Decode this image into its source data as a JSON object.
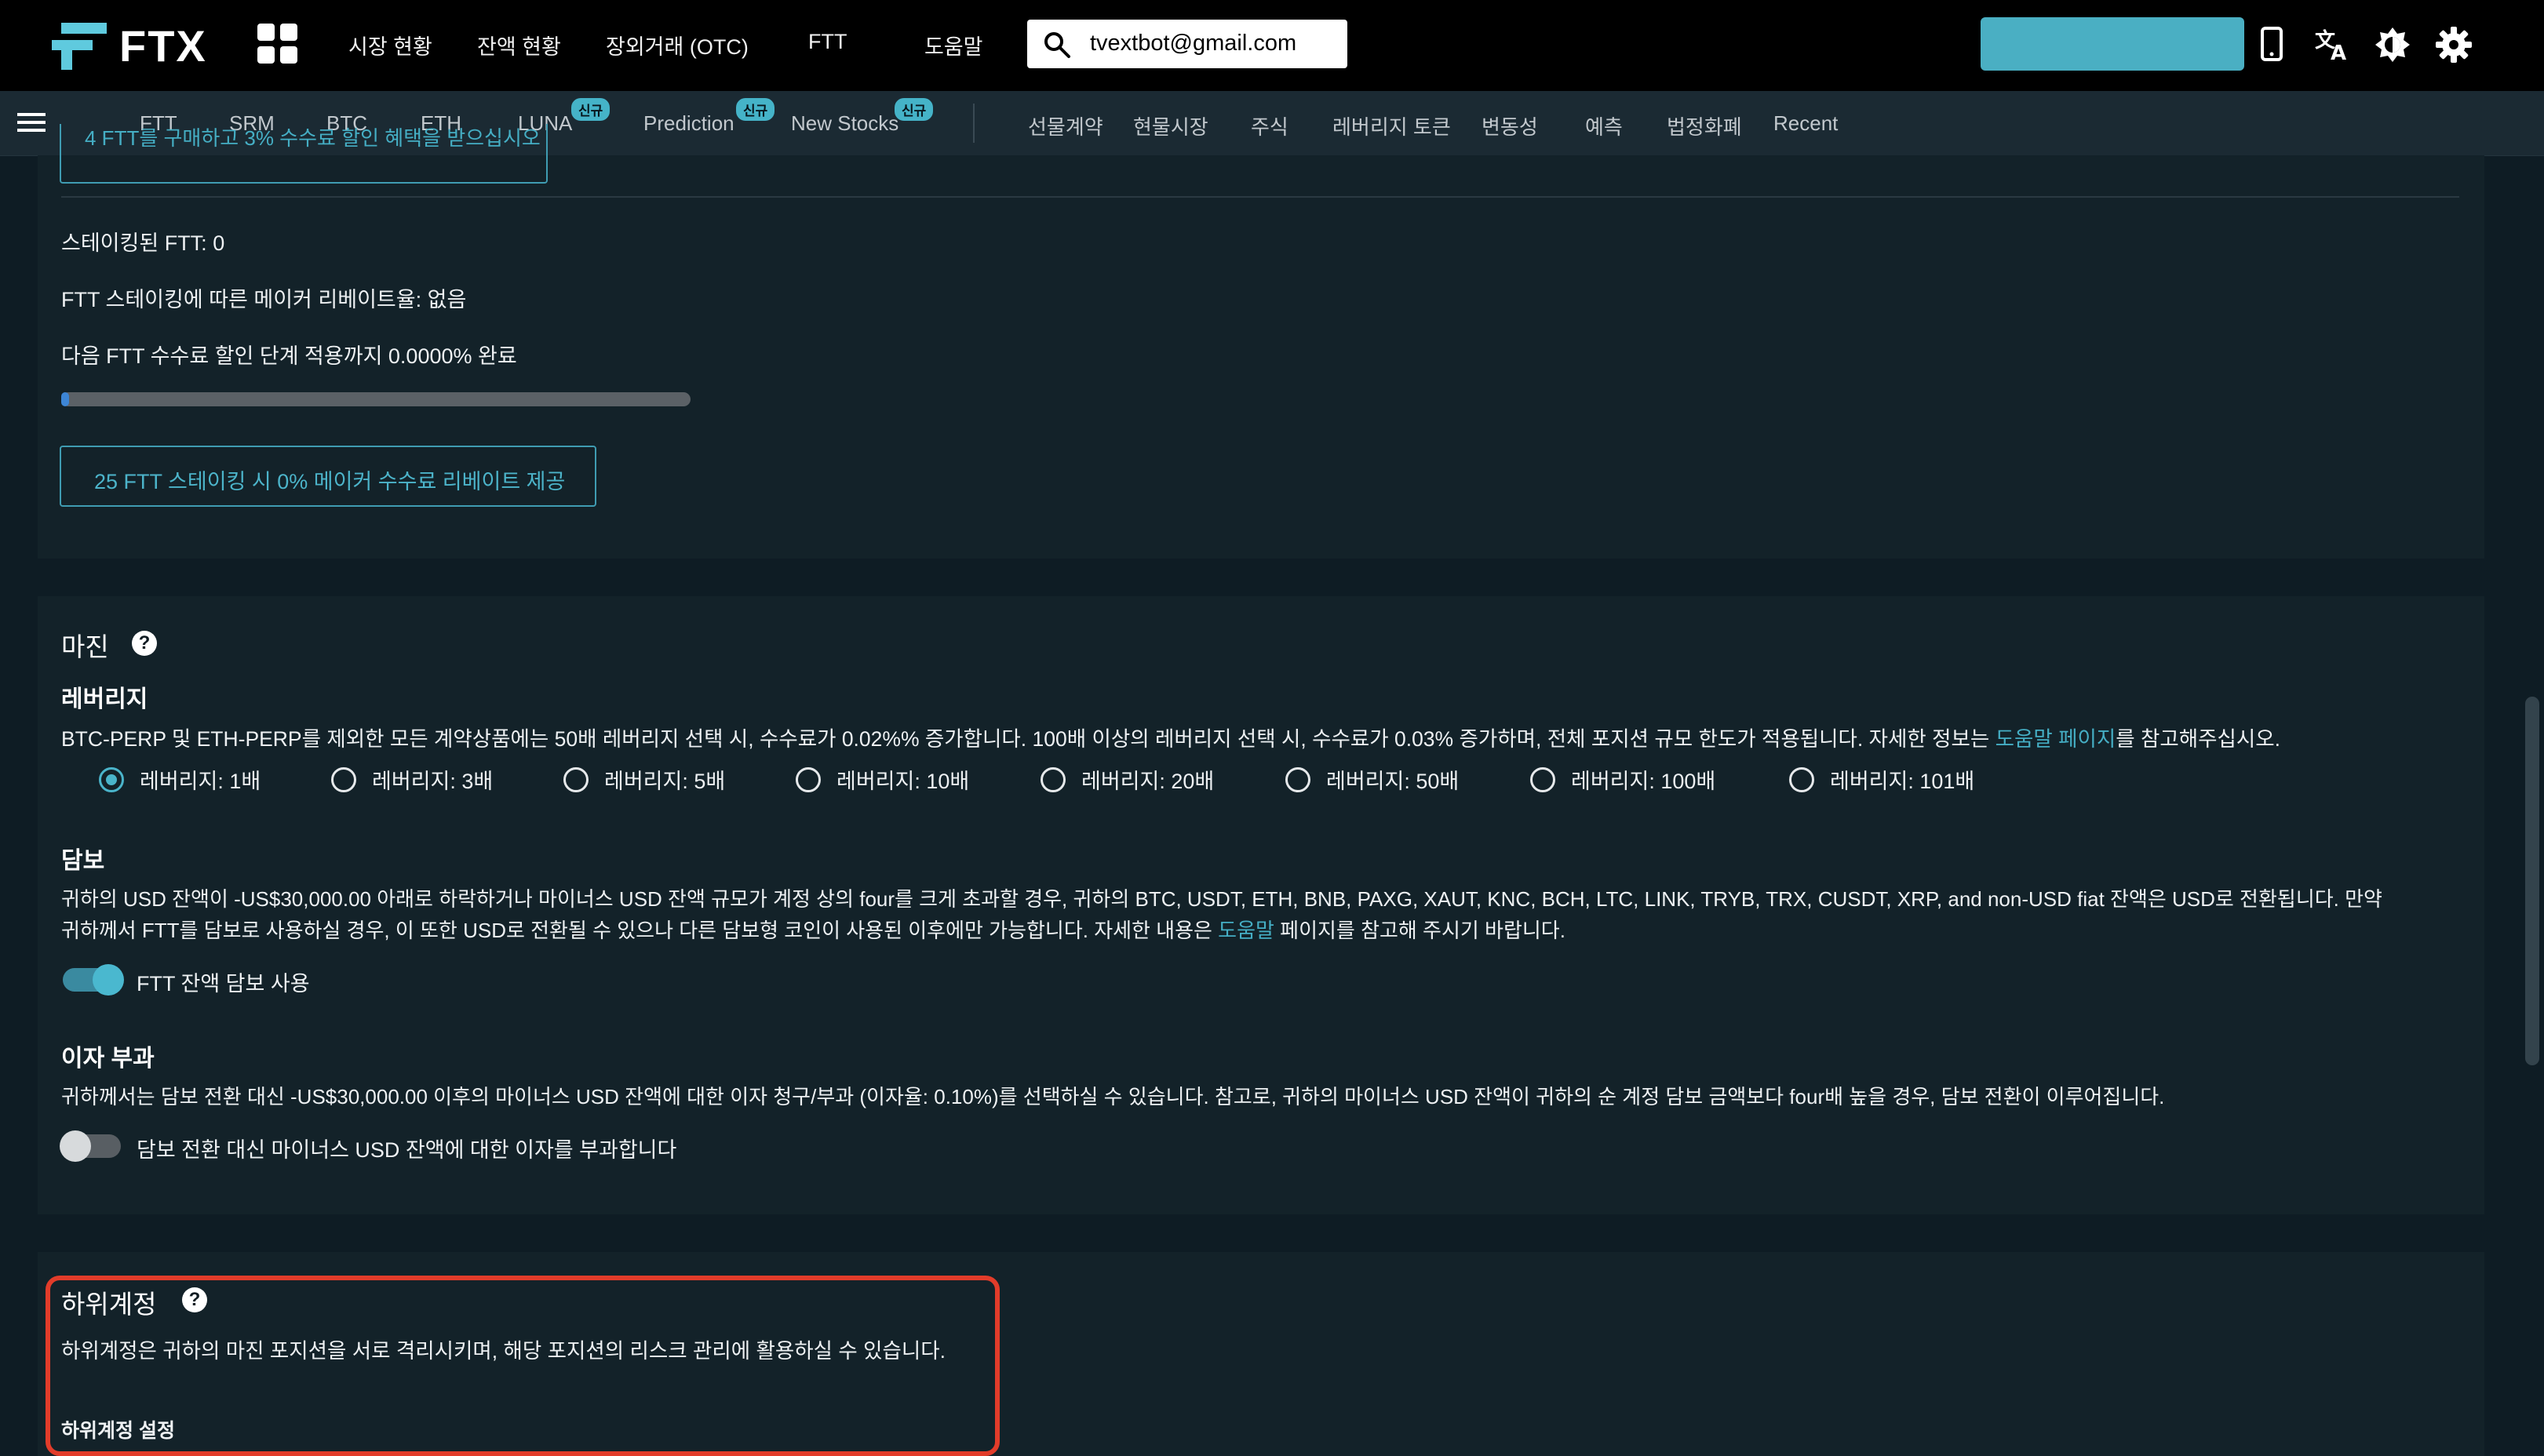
{
  "header": {
    "brand": "FTX",
    "nav": [
      "시장 현황",
      "잔액 현황",
      "장외거래 (OTC)",
      "FTT",
      "도움말"
    ],
    "search_value": "tvextbot@gmail.com",
    "icons": [
      "apps-icon",
      "phone-icon",
      "translate-icon",
      "brightness-icon",
      "gear-icon"
    ],
    "accent_color": "#4aafc3"
  },
  "subnav": {
    "items": [
      {
        "label": "FTT",
        "badge": ""
      },
      {
        "label": "SRM",
        "badge": ""
      },
      {
        "label": "BTC",
        "badge": ""
      },
      {
        "label": "ETH",
        "badge": ""
      },
      {
        "label": "LUNA",
        "badge": "신규"
      },
      {
        "label": "Prediction",
        "badge": "신규"
      },
      {
        "label": "New Stocks",
        "badge": "신규"
      },
      {
        "label": "선물계약",
        "badge": ""
      },
      {
        "label": "현물시장",
        "badge": ""
      },
      {
        "label": "주식",
        "badge": ""
      },
      {
        "label": "레버리지 토큰",
        "badge": ""
      },
      {
        "label": "변동성",
        "badge": ""
      },
      {
        "label": "예측",
        "badge": ""
      },
      {
        "label": "법정화폐",
        "badge": ""
      },
      {
        "label": "Recent",
        "badge": ""
      }
    ]
  },
  "ftt_section": {
    "partial_button": "4 FTT를 구매하고 3% 수수료 할인 혜택을 받으십시오",
    "staked": "스테이킹된 FTT: 0",
    "maker_rebate": "FTT 스테이킹에 따른 메이커 리베이트율: 없음",
    "next_tier": "다음 FTT 수수료 할인 단계 적용까지 0.0000% 완료",
    "progress_percent": 0,
    "rebate_button": "25 FTT 스테이킹 시 0% 메이커 수수료 리베이트 제공"
  },
  "margin_section": {
    "title": "마진",
    "leverage": {
      "title": "레버리지",
      "desc_pre": "BTC-PERP 및 ETH-PERP를 제외한 모든 계약상품에는 50배 레버리지 선택 시, 수수료가 0.02%% 증가합니다. 100배 이상의 레버리지 선택 시, 수수료가 0.03% 증가하며, 전체 포지션 규모 한도가 적용됩니다. 자세한 정보는 ",
      "desc_link": "도움말 페이지",
      "desc_post": "를 참고해주십시오.",
      "options": [
        "레버리지: 1배",
        "레버리지: 3배",
        "레버리지: 5배",
        "레버리지: 10배",
        "레버리지: 20배",
        "레버리지: 50배",
        "레버리지: 100배",
        "레버리지: 101배"
      ],
      "selected_index": 0
    },
    "collateral": {
      "title": "담보",
      "line1": "귀하의 USD 잔액이 -US$30,000.00 아래로 하락하거나 마이너스 USD 잔액 규모가 계정 상의 four를 크게 초과할 경우, 귀하의 BTC, USDT, ETH, BNB, PAXG, XAUT, KNC, BCH, LTC, LINK, TRYB, TRX, CUSDT, XRP, and non-USD fiat 잔액은 USD로 전환됩니다. 만약",
      "line2_pre": "귀하께서 FTT를 담보로 사용하실 경우, 이 또한 USD로 전환될 수 있으나 다른 담보형 코인이 사용된 이후에만 가능합니다. 자세한 내용은 ",
      "line2_link": "도움말",
      "line2_post": " 페이지를 참고해 주시기 바랍니다.",
      "toggle_label": "FTT 잔액 담보 사용",
      "toggle_on": true
    },
    "interest": {
      "title": "이자 부과",
      "desc": "귀하께서는 담보 전환 대신 -US$30,000.00 이후의 마이너스 USD 잔액에 대한 이자 청구/부과 (이자율: 0.10%)를 선택하실 수 있습니다. 참고로, 귀하의 마이너스 USD 잔액이 귀하의 순 계정 담보 금액보다 four배 높을 경우, 담보 전환이 이루어집니다.",
      "toggle_label": "담보 전환 대신 마이너스 USD 잔액에 대한 이자를 부과합니다",
      "toggle_on": false
    }
  },
  "subaccount_section": {
    "title": "하위계정",
    "desc": "하위계정은 귀하의 마진 포지션을 서로 격리시키며, 해당 포지션의 리스크 관리에 활용하실 수 있습니다.",
    "settings_label": "하위계정 설정",
    "highlight_color": "#e23c2a"
  }
}
